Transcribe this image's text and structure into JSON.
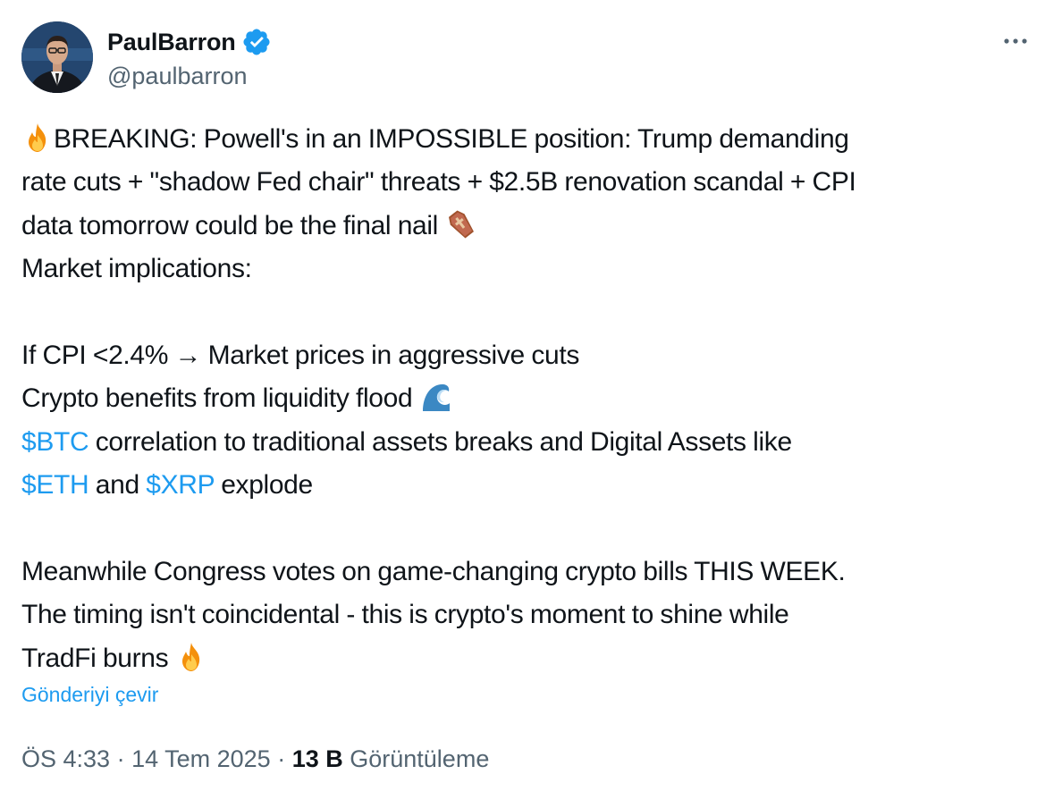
{
  "author": {
    "name": "PaulBarron",
    "handle": "@paulbarron",
    "verified": true,
    "verified_color": "#1d9bf0"
  },
  "menu": {
    "more_icon": "more-horizontal-icon"
  },
  "tweet": {
    "line1": "BREAKING: Powell's in an IMPOSSIBLE position: Trump demanding",
    "line2": "rate cuts + \"shadow Fed chair\" threats + $2.5B renovation scandal + CPI",
    "line3": "data tomorrow could be the final nail",
    "line4": "Market implications:",
    "line5": "If CPI <2.4% → Market prices in aggressive cuts",
    "line6": "Crypto benefits from liquidity flood",
    "btc_tag": "$BTC",
    "line7_rest": " correlation to traditional assets breaks and Digital Assets like",
    "eth_tag": "$ETH",
    "and_text": " and ",
    "xrp_tag": "$XRP",
    "explode_text": " explode",
    "line9": "Meanwhile Congress votes on game-changing crypto bills THIS WEEK.",
    "line10": "The timing isn't coincidental - this is crypto's moment to shine while",
    "line11": "TradFi burns",
    "emojis": [
      "fire-emoji",
      "coffin-emoji",
      "wave-emoji",
      "fire-emoji"
    ],
    "link_color": "#1d9bf0"
  },
  "translate_label": "Gönderiyi çevir",
  "meta": {
    "time": "ÖS 4:33",
    "separator": " · ",
    "date": "14 Tem 2025",
    "views_count": "13 B",
    "views_label": "Görüntüleme"
  }
}
